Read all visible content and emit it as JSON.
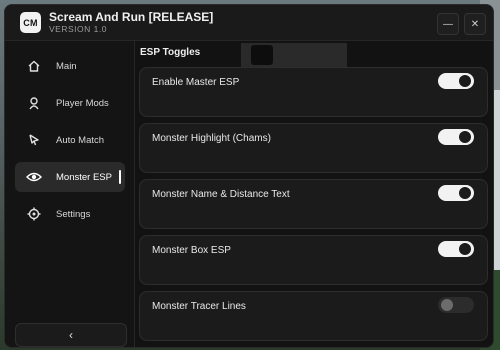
{
  "app": {
    "logo_text": "CM",
    "title": "Scream And Run [RELEASE]",
    "version": "VERSION 1.0",
    "minimize_glyph": "—",
    "close_glyph": "✕"
  },
  "sidebar": {
    "items": [
      {
        "label": "Main",
        "icon": "home-icon",
        "active": false
      },
      {
        "label": "Player Mods",
        "icon": "user-icon",
        "active": false
      },
      {
        "label": "Auto Match",
        "icon": "cursor-icon",
        "active": false
      },
      {
        "label": "Monster ESP",
        "icon": "eye-icon",
        "active": true
      },
      {
        "label": "Settings",
        "icon": "crosshair-icon",
        "active": false
      }
    ],
    "collapse_glyph": "‹"
  },
  "main": {
    "section_title": "ESP Toggles",
    "toggles": [
      {
        "label": "Enable Master ESP",
        "on": true
      },
      {
        "label": "Monster Highlight (Chams)",
        "on": true
      },
      {
        "label": "Monster Name & Distance Text",
        "on": true
      },
      {
        "label": "Monster Box ESP",
        "on": true
      },
      {
        "label": "Monster Tracer Lines",
        "on": false
      }
    ]
  },
  "colors": {
    "window_bg": "#141414",
    "card_bg": "#1b1b1b",
    "toggle_on": "#f2f2f2",
    "toggle_off": "#2c2c2c"
  }
}
